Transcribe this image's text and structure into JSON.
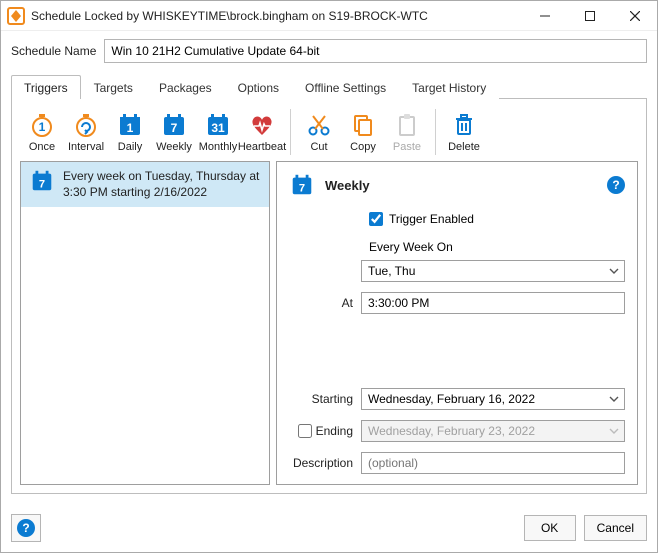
{
  "window": {
    "title": "Schedule Locked by WHISKEYTIME\\brock.bingham on S19-BROCK-WTC"
  },
  "schedule": {
    "name_label": "Schedule Name",
    "name_value": "Win 10 21H2 Cumulative Update 64-bit"
  },
  "tabs": {
    "triggers": "Triggers",
    "targets": "Targets",
    "packages": "Packages",
    "options": "Options",
    "offline": "Offline Settings",
    "history": "Target History"
  },
  "toolbar": {
    "once": "Once",
    "interval": "Interval",
    "daily": "Daily",
    "weekly": "Weekly",
    "monthly": "Monthly",
    "heartbeat": "Heartbeat",
    "cut": "Cut",
    "copy": "Copy",
    "paste": "Paste",
    "delete": "Delete"
  },
  "list": {
    "item0": "Every week on Tuesday, Thursday at 3:30 PM starting 2/16/2022"
  },
  "pane": {
    "title": "Weekly",
    "trigger_enabled_label": "Trigger Enabled",
    "trigger_enabled": true,
    "every_week_on_label": "Every Week On",
    "days_value": "Tue, Thu",
    "at_label": "At",
    "at_value": "3:30:00 PM",
    "starting_label": "Starting",
    "starting_value": "Wednesday, February 16, 2022",
    "ending_label": "Ending",
    "ending_enabled": false,
    "ending_value": "Wednesday, February 23, 2022",
    "description_label": "Description",
    "description_placeholder": "(optional)"
  },
  "footer": {
    "ok": "OK",
    "cancel": "Cancel"
  },
  "colors": {
    "accent": "#0b7bd1",
    "selection": "#cfe8f6",
    "orange": "#f08a1d",
    "red": "#d23b3b"
  }
}
